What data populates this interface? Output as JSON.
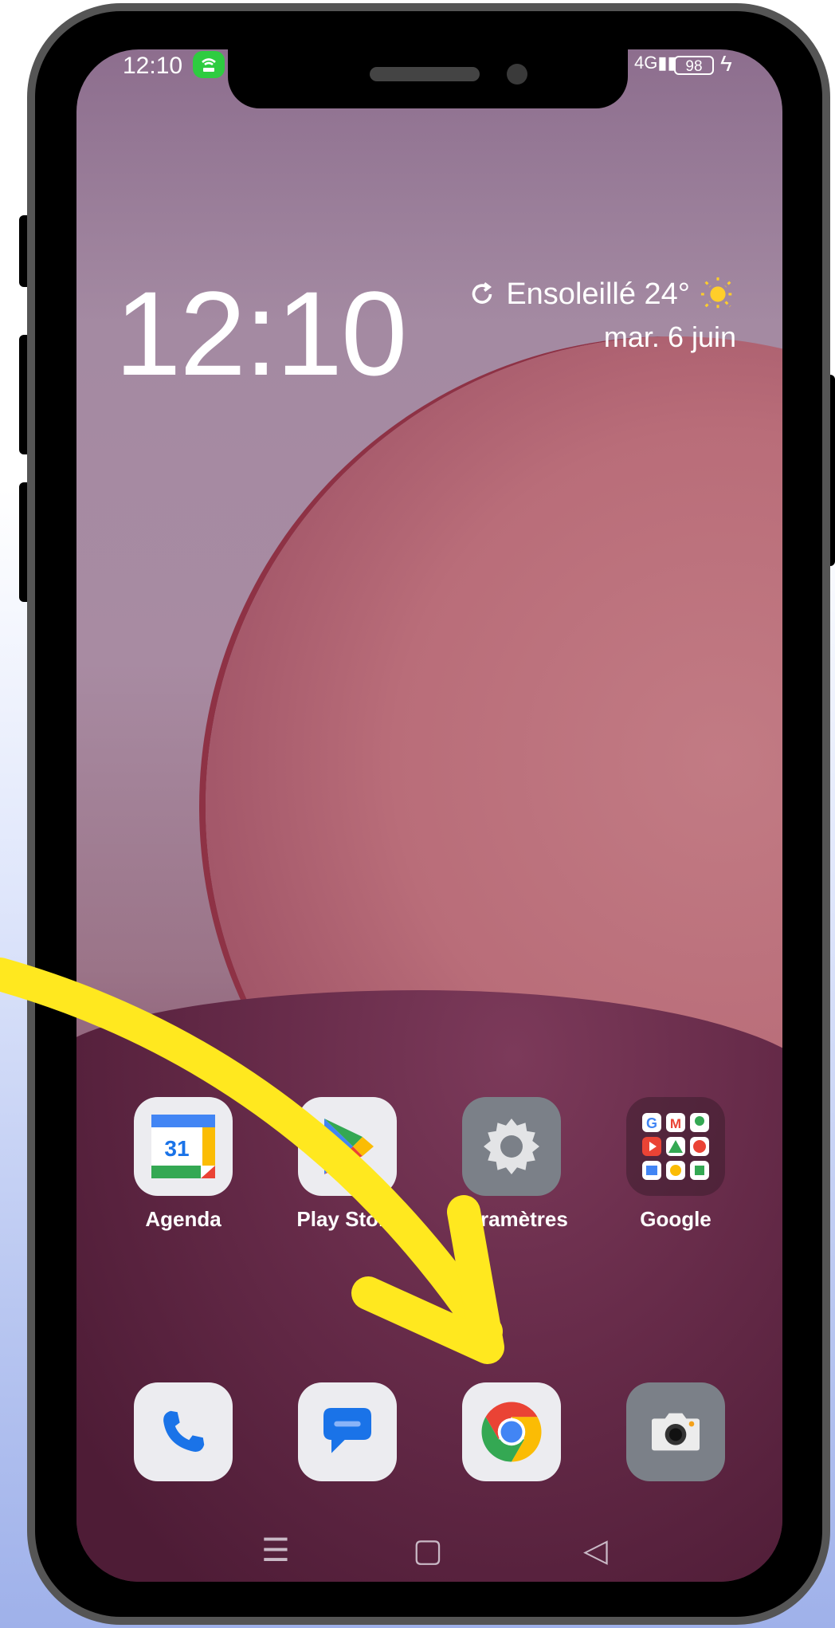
{
  "status_bar": {
    "time": "12:10",
    "signal": "4G",
    "battery": "98"
  },
  "clock": {
    "time": "12:10"
  },
  "weather": {
    "text": "Ensoleillé 24°",
    "date": "mar. 6 juin"
  },
  "apps_row": [
    {
      "label": "Agenda",
      "icon": "calendar-icon",
      "day": "31"
    },
    {
      "label": "Play Store",
      "icon": "play-store-icon"
    },
    {
      "label": "Paramètres",
      "icon": "settings-icon"
    },
    {
      "label": "Google",
      "icon": "google-folder-icon"
    }
  ],
  "dock": [
    {
      "icon": "phone-icon"
    },
    {
      "icon": "messages-icon"
    },
    {
      "icon": "chrome-icon"
    },
    {
      "icon": "camera-icon"
    }
  ],
  "colors": {
    "arrow": "#ffe81f",
    "hotspot": "#2ecc40"
  }
}
